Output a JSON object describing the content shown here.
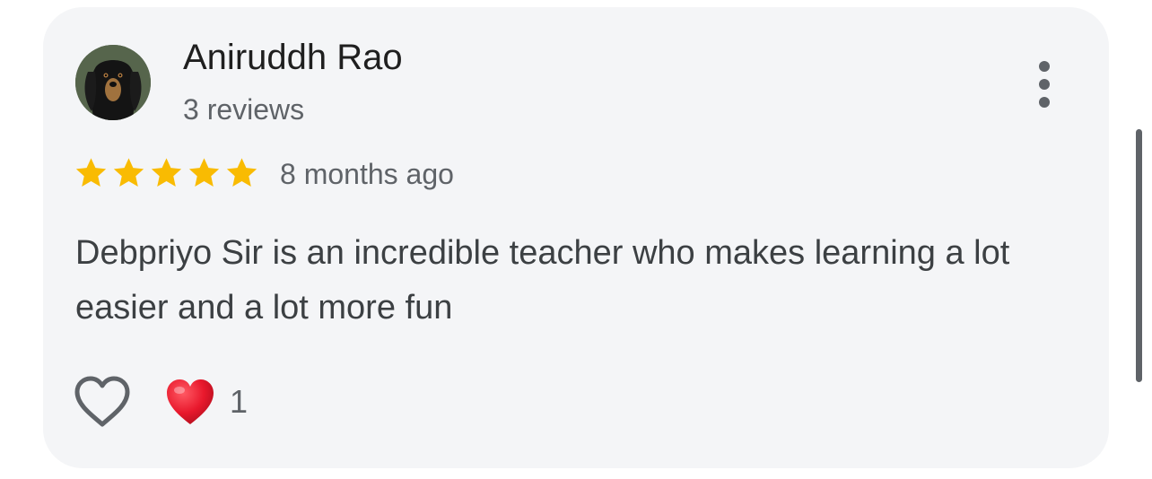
{
  "review": {
    "author_name": "Aniruddh Rao",
    "author_review_count": "3 reviews",
    "avatar_icon": "dog-avatar-icon",
    "rating": 5,
    "rating_max": 5,
    "time_ago": "8 months ago",
    "text": "Debpriyo Sir is an incredible teacher who makes learning a lot easier and a lot more fun",
    "reaction_count": "1",
    "reaction_icon": "red-heart-icon",
    "like_icon": "heart-outline-icon",
    "menu_icon": "more-vertical-icon"
  },
  "colors": {
    "card_background": "#f4f5f7",
    "star": "#f9bb02",
    "heart_red": "#e8182c",
    "secondary_text": "#5f6368",
    "primary_text": "#1f1f1f"
  }
}
